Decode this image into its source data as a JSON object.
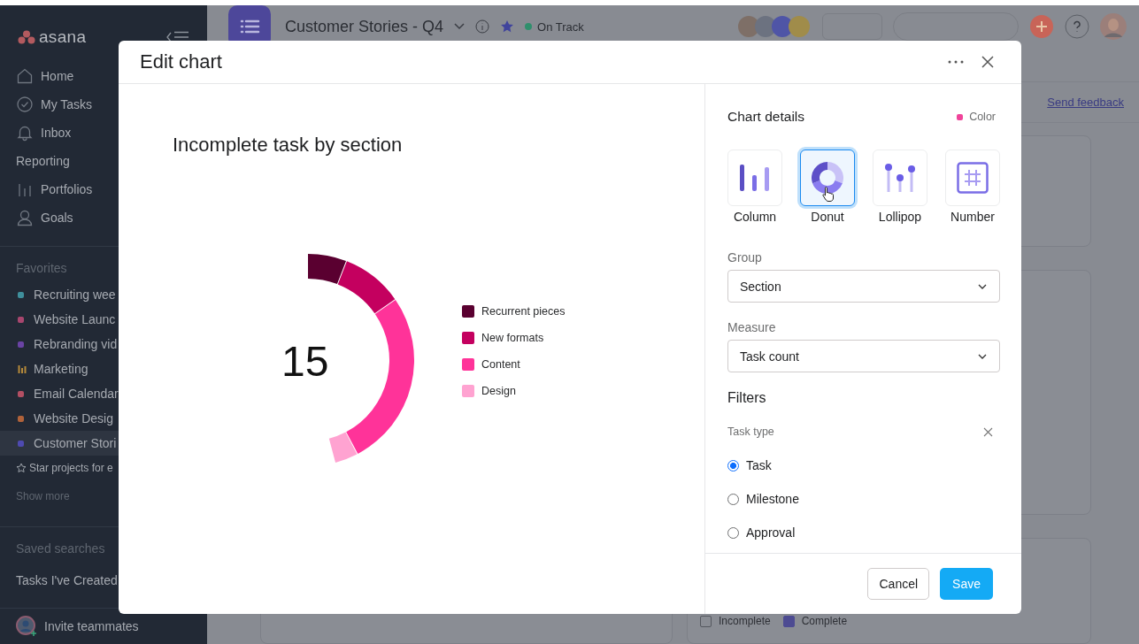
{
  "sidebar": {
    "logo": "asana",
    "nav": [
      {
        "label": "Home",
        "kind": "home"
      },
      {
        "label": "My Tasks",
        "kind": "check"
      },
      {
        "label": "Inbox",
        "kind": "bell"
      },
      {
        "label": "Reporting",
        "kind": "heading"
      },
      {
        "label": "Portfolios",
        "kind": "bars"
      },
      {
        "label": "Goals",
        "kind": "person"
      }
    ],
    "favorites_heading": "Favorites",
    "favorites": [
      {
        "label": "Recruiting wee",
        "kind": "dot",
        "color": "#3f8f9c",
        "selected": false
      },
      {
        "label": "Website Launc",
        "kind": "dot",
        "color": "#a8466e",
        "selected": false
      },
      {
        "label": "Rebranding vid",
        "kind": "dot",
        "color": "#6a43a4",
        "selected": false
      },
      {
        "label": "Marketing",
        "kind": "bars",
        "color": "#b58a3a",
        "selected": false
      },
      {
        "label": "Email Calendar",
        "kind": "dot",
        "color": "#b34f63",
        "selected": false
      },
      {
        "label": "Website Desig",
        "kind": "dot",
        "color": "#b0623a",
        "selected": false
      },
      {
        "label": "Customer Stori",
        "kind": "dot",
        "color": "#4e4ab0",
        "selected": true
      }
    ],
    "star_hint": "Star projects for e",
    "show_more": "Show more",
    "saved_heading": "Saved searches",
    "saved": [
      "Tasks I've Created"
    ],
    "invite": "Invite teammates"
  },
  "project": {
    "title": "Customer Stories - Q4",
    "status": "On Track"
  },
  "feedback_link": "Send feedback",
  "card_legend": [
    {
      "label": "Incomplete",
      "kind": "outline"
    },
    {
      "label": "Complete",
      "kind": "filled"
    }
  ],
  "modal": {
    "title": "Edit chart",
    "chart_title": "Incomplete task by section",
    "total": "15",
    "legend": [
      {
        "label": "Recurrent pieces",
        "color": "#5a0030"
      },
      {
        "label": "New formats",
        "color": "#c4005f"
      },
      {
        "label": "Content",
        "color": "#ff3399"
      },
      {
        "label": "Design",
        "color": "#ffa3d1"
      }
    ],
    "details_heading": "Chart details",
    "color_label": "Color",
    "color": "#f0449a",
    "chart_types": [
      {
        "label": "Column",
        "kind": "column",
        "selected": false
      },
      {
        "label": "Donut",
        "kind": "donut",
        "selected": true
      },
      {
        "label": "Lollipop",
        "kind": "lollipop",
        "selected": false
      },
      {
        "label": "Number",
        "kind": "number",
        "selected": false
      }
    ],
    "group": {
      "label": "Group",
      "value": "Section"
    },
    "measure": {
      "label": "Measure",
      "value": "Task count"
    },
    "filters_heading": "Filters",
    "filter": {
      "label": "Task type",
      "options": [
        {
          "label": "Task",
          "selected": true
        },
        {
          "label": "Milestone",
          "selected": false
        },
        {
          "label": "Approval",
          "selected": false
        }
      ]
    },
    "cancel": "Cancel",
    "save": "Save"
  }
}
